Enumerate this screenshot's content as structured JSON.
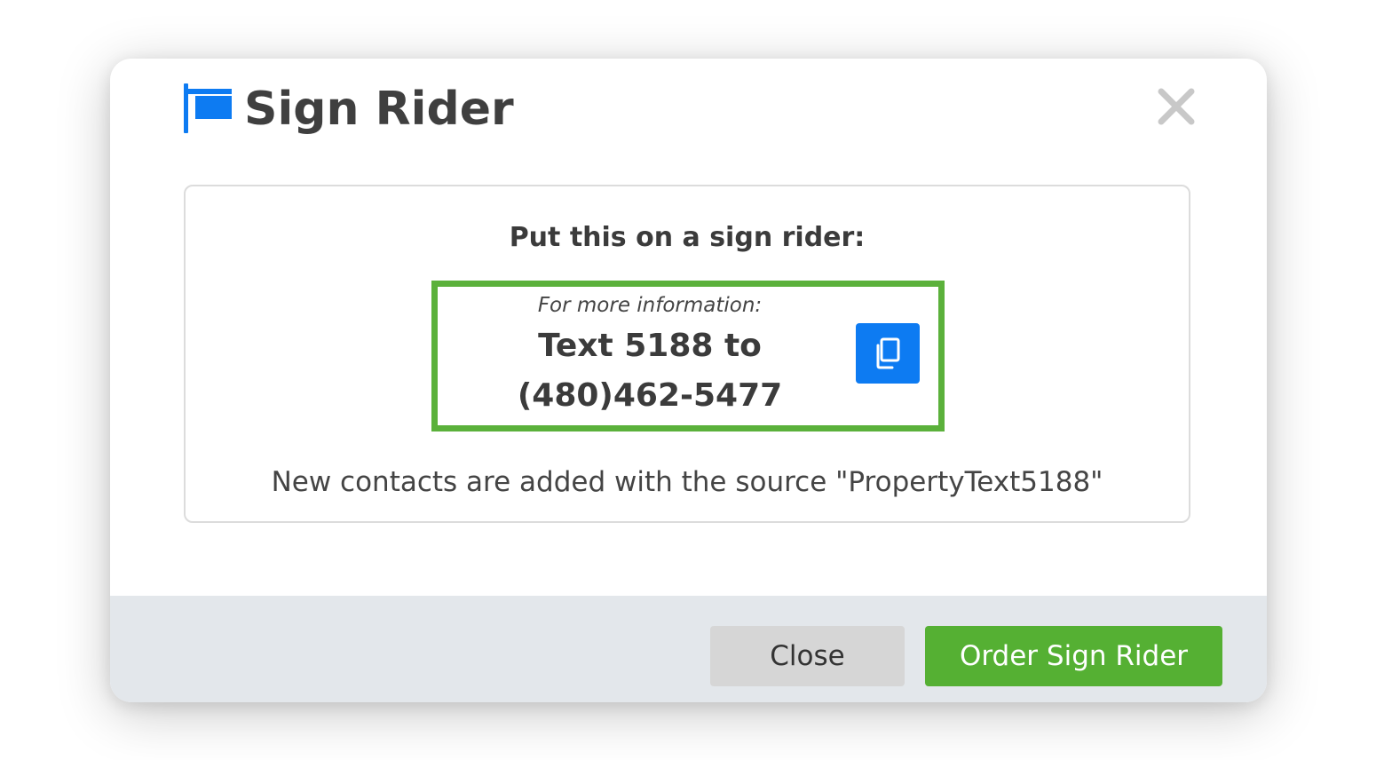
{
  "modal": {
    "title": "Sign Rider",
    "title_icon": "flag-icon",
    "close_icon": "close-icon"
  },
  "content": {
    "heading": "Put this on a sign rider:",
    "rider": {
      "subtitle": "For more information:",
      "line1": "Text 5188 to",
      "line2": "(480)462-5477",
      "copy_icon": "copy-icon"
    },
    "source_note": "New contacts are added with the source \"PropertyText5188\""
  },
  "footer": {
    "close_label": "Close",
    "order_label": "Order Sign Rider"
  },
  "colors": {
    "accent_blue": "#0d7bf2",
    "accent_green": "#55b033",
    "rider_border": "#5bb13b",
    "footer_bg": "#e3e7eb"
  }
}
